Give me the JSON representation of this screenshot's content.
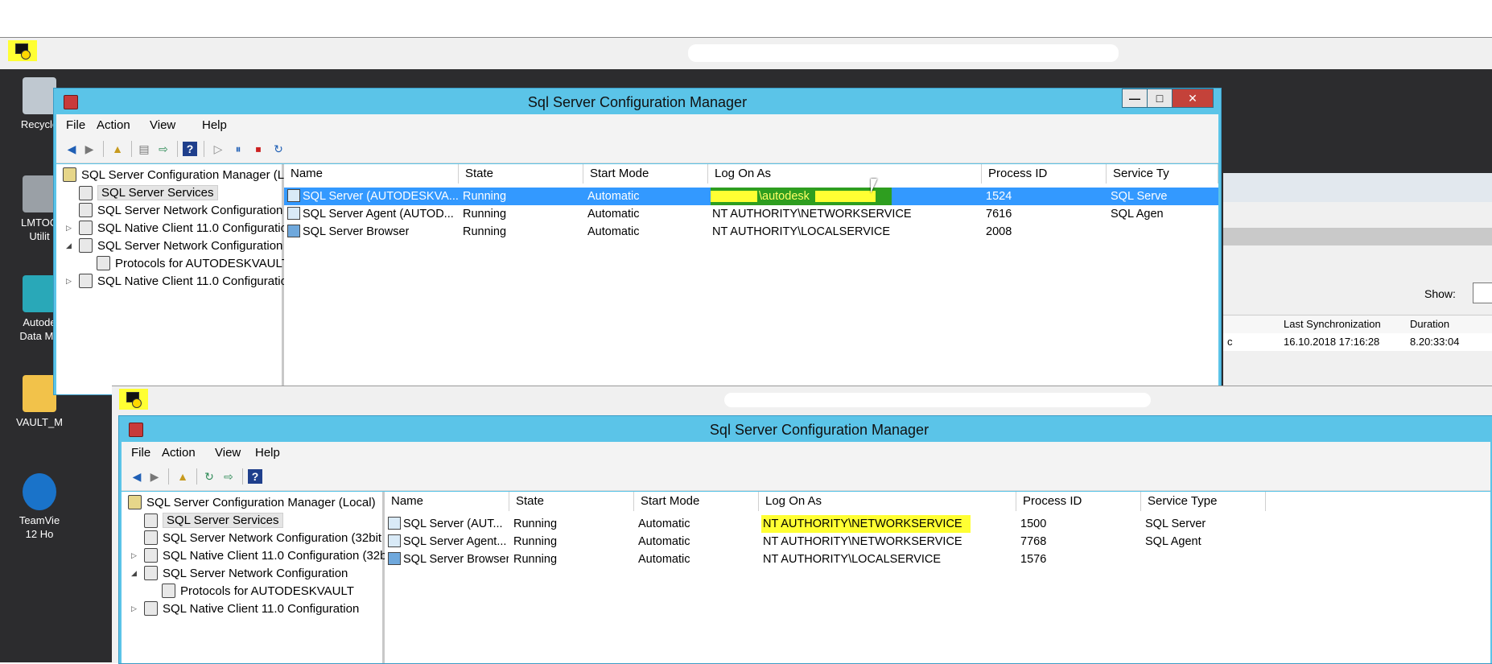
{
  "outer_window": {
    "title": "Sql Server Configuration Manager"
  },
  "menu": [
    "File",
    "Action",
    "View",
    "Help"
  ],
  "desktop_icons": [
    {
      "label": "Recycle"
    },
    {
      "label": "LMTOO",
      "sub": "Utilit"
    },
    {
      "label": "Autode",
      "sub": "Data Ma"
    },
    {
      "label": "VAULT_M"
    },
    {
      "label": "TeamVie",
      "sub": "12 Ho"
    }
  ],
  "tree": {
    "root": "SQL Server Configuration Manager (Local)",
    "items": [
      "SQL Server Services",
      "SQL Server Network Configuration (32bit",
      "SQL Native Client 11.0 Configuration (32b",
      "SQL Server Network Configuration",
      "Protocols for AUTODESKVAULT",
      "SQL Native Client 11.0 Configuration"
    ]
  },
  "columns": [
    "Name",
    "State",
    "Start Mode",
    "Log On As",
    "Process ID",
    "Service Type"
  ],
  "upper_rows": [
    {
      "name": "SQL Server (AUTODESKVA...",
      "state": "Running",
      "start": "Automatic",
      "logon": "\\autodesk",
      "pid": "1524",
      "type": "SQL Serve"
    },
    {
      "name": "SQL Server Agent (AUTOD...",
      "state": "Running",
      "start": "Automatic",
      "logon": "NT AUTHORITY\\NETWORKSERVICE",
      "pid": "7616",
      "type": "SQL Agen"
    },
    {
      "name": "SQL Server Browser",
      "state": "Running",
      "start": "Automatic",
      "logon": "NT AUTHORITY\\LOCALSERVICE",
      "pid": "2008",
      "type": ""
    }
  ],
  "upper_service_type_header": "Service Ty",
  "lower_rows": [
    {
      "name": "SQL Server (AUT...",
      "state": "Running",
      "start": "Automatic",
      "logon": "NT AUTHORITY\\NETWORKSERVICE",
      "pid": "1500",
      "type": "SQL Server"
    },
    {
      "name": "SQL Server Agent...",
      "state": "Running",
      "start": "Automatic",
      "logon": "NT AUTHORITY\\NETWORKSERVICE",
      "pid": "7768",
      "type": "SQL Agent"
    },
    {
      "name": "SQL Server Browser",
      "state": "Running",
      "start": "Automatic",
      "logon": "NT AUTHORITY\\LOCALSERVICE",
      "pid": "1576",
      "type": ""
    }
  ],
  "bg_app": {
    "show_label": "Show:",
    "col_last_sync": "Last Synchronization",
    "col_duration": "Duration",
    "row_prefix": "c",
    "last_sync": "16.10.2018 17:16:28",
    "duration": "8.20:33:04"
  },
  "colors": {
    "titlebar": "#5bc4e8",
    "highlight": "#ffff33",
    "selection": "#3399ff",
    "close": "#c4423a"
  }
}
